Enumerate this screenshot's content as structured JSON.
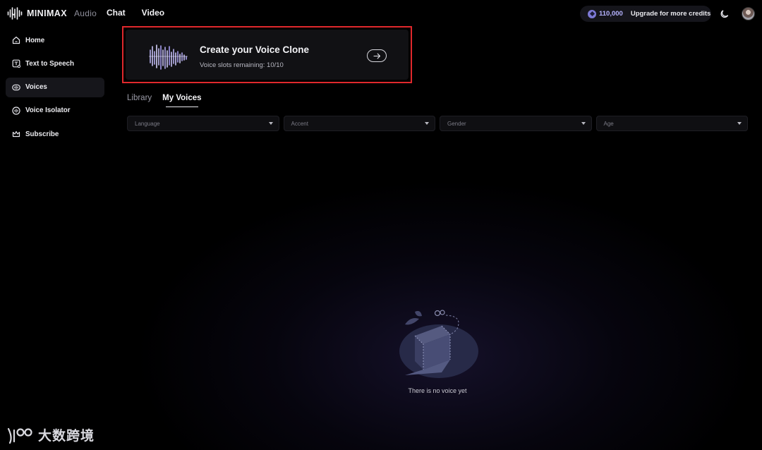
{
  "brand": {
    "name": "MINIMAX",
    "product": "Audio"
  },
  "topnav": {
    "items": [
      "Chat",
      "Video"
    ]
  },
  "credits": {
    "value": "110,000",
    "upgrade_label": "Upgrade for more credits"
  },
  "sidebar": {
    "items": [
      {
        "label": "Home",
        "icon": "home-icon",
        "active": false
      },
      {
        "label": "Text to Speech",
        "icon": "text-to-speech-icon",
        "active": false
      },
      {
        "label": "Voices",
        "icon": "voices-icon",
        "active": true
      },
      {
        "label": "Voice Isolator",
        "icon": "voice-isolator-icon",
        "active": false
      },
      {
        "label": "Subscribe",
        "icon": "crown-icon",
        "active": false
      }
    ]
  },
  "banner": {
    "title": "Create your Voice Clone",
    "subtitle": "Voice slots remaining: 10/10"
  },
  "tabs": [
    {
      "label": "Library",
      "active": false
    },
    {
      "label": "My Voices",
      "active": true
    }
  ],
  "filters": [
    {
      "placeholder": "Language"
    },
    {
      "placeholder": "Accent"
    },
    {
      "placeholder": "Gender"
    },
    {
      "placeholder": "Age"
    }
  ],
  "empty_state": {
    "message": "There is no voice yet"
  },
  "watermark": {
    "text": "大数跨境"
  },
  "colors": {
    "accent": "#7d7ad6",
    "credit_text": "#b6b3ff",
    "highlight_border": "#e0282c",
    "background": "#000000"
  }
}
